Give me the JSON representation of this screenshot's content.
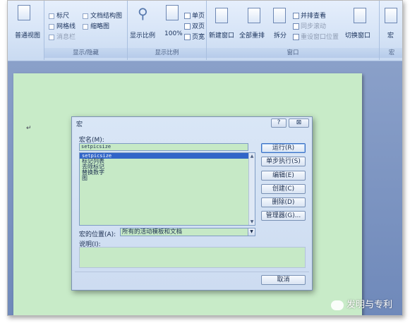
{
  "ribbon": {
    "doc_views": {
      "normal_view_label": "普通视图"
    },
    "show_hide": {
      "ruler": "标尺",
      "gridlines": "网格线",
      "message_bar": "消息栏",
      "doc_map": "文档结构图",
      "thumbnails": "缩略图",
      "group_label": "显示/隐藏"
    },
    "zoom": {
      "zoom_label": "显示比例",
      "hundred_label": "100%",
      "one_page": "单页",
      "two_pages": "双页",
      "page_width": "页宽",
      "group_label": "显示比例"
    },
    "window": {
      "new_window": "新建窗口",
      "arrange_all": "全部重排",
      "split": "拆分",
      "side_by_side": "并排查看",
      "sync_scroll": "同步滚动",
      "reset_pos": "重设窗口位置",
      "switch_windows": "切换窗口",
      "group_label": "窗口"
    },
    "macros": {
      "macros_label": "宏",
      "group_label": "宏"
    }
  },
  "document": {
    "paragraph_mark": "↵"
  },
  "dialog": {
    "title": "宏",
    "help_label": "?",
    "close_label": "⊠",
    "macro_name_label": "宏名(M):",
    "macro_name_value": "setpicsize",
    "macro_list": [
      "setpicsize",
      "标记列表",
      "去除标记",
      "替换数字",
      "图"
    ],
    "buttons": {
      "run": "运行(R)",
      "step_into": "单步执行(S)",
      "edit": "编辑(E)",
      "create": "创建(C)",
      "delete": "删除(D)",
      "organizer": "管理器(G)...",
      "cancel": "取消"
    },
    "macros_in_label": "宏的位置(A):",
    "macros_in_value": "所有的活动模板和文档",
    "description_label": "说明(I):"
  },
  "watermark": {
    "text": "发明与专利"
  }
}
